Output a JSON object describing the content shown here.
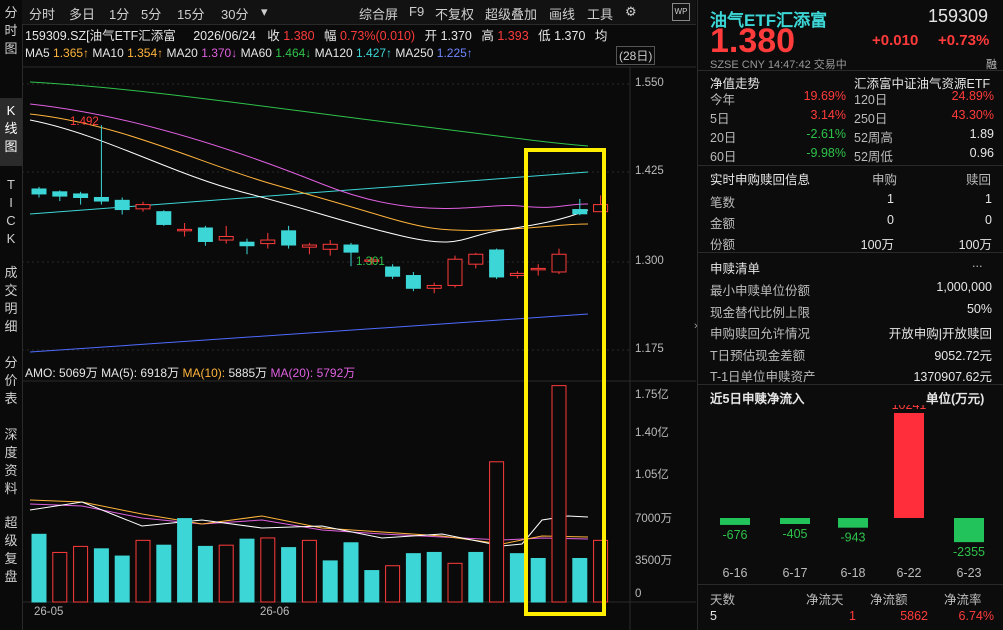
{
  "leftnav": {
    "items": [
      {
        "label": "分\n时\n图"
      },
      {
        "label": "K\n线\n图"
      },
      {
        "label": "T\nI\nC\nK"
      },
      {
        "label": "成\n交\n明\n细"
      },
      {
        "label": "分\n价\n表"
      },
      {
        "label": "深\n度\n资\n料"
      },
      {
        "label": "超\n级\n复\n盘"
      }
    ]
  },
  "toolbar": {
    "periods": [
      "分时",
      "多日",
      "1分",
      "5分",
      "15分",
      "30分"
    ],
    "dropdown": "▾",
    "actions": [
      "综合屏",
      "F9",
      "不复权",
      "超级叠加",
      "画线",
      "工具"
    ],
    "settings_icon": "gear-icon",
    "wp_badge": "WP"
  },
  "header": {
    "code_name": "159309.SZ[油气ETF汇添富",
    "date": "2026/06/24",
    "close_label": "收",
    "close_value": "1.380",
    "change_label": "幅",
    "change_value": "0.73%(0.010)",
    "open_label": "开",
    "open_value": "1.370",
    "high_label": "高",
    "high_value": "1.393",
    "low_label": "低",
    "low_value": "1.370",
    "avg_label": "均"
  },
  "ma_line": {
    "ma5": {
      "label": "MA5",
      "value": "1.365↑",
      "color": "#ffffff"
    },
    "ma10": {
      "label": "MA10",
      "value": "1.354↑",
      "color": "#ffb43c"
    },
    "ma20": {
      "label": "MA20",
      "value": "1.370↓",
      "color": "#e060e0"
    },
    "ma60": {
      "label": "MA60",
      "value": "1.464↓",
      "color": "#2fc24b"
    },
    "ma120": {
      "label": "MA120",
      "value": "1.427↑",
      "color": "#3dd6d6"
    },
    "ma250": {
      "label": "MA250",
      "value": "1.225↑",
      "color": "#4f6cff"
    },
    "period_tag": "(28日)"
  },
  "price_axis": [
    "1.550",
    "1.425",
    "1.300",
    "1.175"
  ],
  "annotations": {
    "high": "1.492",
    "low": "1.301"
  },
  "volume": {
    "amo_label": "AMO:",
    "amo_value": "5069万",
    "ma5_label": "MA(5):",
    "ma5_value": "6918万",
    "ma10_label": "MA(10):",
    "ma10_value": "5885万",
    "ma20_label": "MA(20):",
    "ma20_value": "5792万",
    "axis": [
      "1.75亿",
      "1.40亿",
      "1.05亿",
      "7000万",
      "3500万",
      "0"
    ]
  },
  "date_axis": [
    "26-05",
    "26-06"
  ],
  "chart_data": {
    "type": "candlestick",
    "ylim": [
      1.16,
      1.57
    ],
    "candles": [
      {
        "o": 1.402,
        "c": 1.395,
        "h": 1.405,
        "l": 1.39
      },
      {
        "o": 1.398,
        "c": 1.392,
        "h": 1.4,
        "l": 1.385
      },
      {
        "o": 1.395,
        "c": 1.39,
        "h": 1.398,
        "l": 1.38
      },
      {
        "o": 1.39,
        "c": 1.385,
        "h": 1.492,
        "l": 1.38
      },
      {
        "o": 1.386,
        "c": 1.373,
        "h": 1.39,
        "l": 1.366
      },
      {
        "o": 1.374,
        "c": 1.38,
        "h": 1.384,
        "l": 1.37
      },
      {
        "o": 1.37,
        "c": 1.352,
        "h": 1.372,
        "l": 1.35
      },
      {
        "o": 1.343,
        "c": 1.345,
        "h": 1.354,
        "l": 1.335
      },
      {
        "o": 1.347,
        "c": 1.328,
        "h": 1.35,
        "l": 1.322
      },
      {
        "o": 1.33,
        "c": 1.335,
        "h": 1.35,
        "l": 1.325
      },
      {
        "o": 1.327,
        "c": 1.322,
        "h": 1.332,
        "l": 1.31
      },
      {
        "o": 1.325,
        "c": 1.33,
        "h": 1.34,
        "l": 1.318
      },
      {
        "o": 1.343,
        "c": 1.323,
        "h": 1.35,
        "l": 1.318
      },
      {
        "o": 1.32,
        "c": 1.323,
        "h": 1.326,
        "l": 1.31
      },
      {
        "o": 1.317,
        "c": 1.324,
        "h": 1.33,
        "l": 1.308
      },
      {
        "o": 1.323,
        "c": 1.313,
        "h": 1.326,
        "l": 1.293
      },
      {
        "o": 1.3,
        "c": 1.302,
        "h": 1.306,
        "l": 1.295
      },
      {
        "o": 1.292,
        "c": 1.279,
        "h": 1.296,
        "l": 1.275
      },
      {
        "o": 1.28,
        "c": 1.262,
        "h": 1.285,
        "l": 1.258
      },
      {
        "o": 1.262,
        "c": 1.266,
        "h": 1.27,
        "l": 1.255
      },
      {
        "o": 1.266,
        "c": 1.303,
        "h": 1.308,
        "l": 1.263
      },
      {
        "o": 1.296,
        "c": 1.31,
        "h": 1.312,
        "l": 1.29
      },
      {
        "o": 1.316,
        "c": 1.278,
        "h": 1.318,
        "l": 1.275
      },
      {
        "o": 1.28,
        "c": 1.283,
        "h": 1.286,
        "l": 1.276
      },
      {
        "o": 1.288,
        "c": 1.29,
        "h": 1.296,
        "l": 1.28
      },
      {
        "o": 1.285,
        "c": 1.31,
        "h": 1.318,
        "l": 1.282
      },
      {
        "o": 1.373,
        "c": 1.367,
        "h": 1.388,
        "l": 1.365
      },
      {
        "o": 1.37,
        "c": 1.38,
        "h": 1.393,
        "l": 1.37
      }
    ],
    "volumes": [
      5.6,
      4.1,
      4.6,
      4.4,
      3.8,
      5.1,
      4.7,
      6.9,
      4.6,
      4.7,
      5.2,
      5.3,
      4.5,
      5.1,
      3.4,
      4.9,
      2.6,
      3.0,
      4.0,
      4.1,
      3.2,
      4.1,
      11.6,
      4.0,
      3.6,
      17.9,
      3.6,
      5.1
    ],
    "volume_up": [
      false,
      true,
      true,
      false,
      false,
      true,
      false,
      false,
      false,
      true,
      false,
      true,
      false,
      true,
      false,
      false,
      false,
      true,
      false,
      false,
      true,
      false,
      true,
      false,
      false,
      true,
      false,
      true
    ],
    "volume_ylim": [
      0,
      18.2
    ]
  },
  "quote": {
    "name": "油气ETF汇添富",
    "code": "159309",
    "price": "1.380",
    "change": "+0.010",
    "change_pct": "+0.73%",
    "exchange": "SZSE",
    "currency": "CNY",
    "time": "14:47:42",
    "status": "交易中",
    "tag": "融"
  },
  "nav_section": {
    "title": "净值走势",
    "index_name": "汇添富中证油气资源ETF",
    "rows": [
      {
        "l1": "今年",
        "v1": "19.69%",
        "l2": "120日",
        "v2": "24.89%",
        "c1": "red",
        "c2": "red"
      },
      {
        "l1": "5日",
        "v1": "3.14%",
        "l2": "250日",
        "v2": "43.30%",
        "c1": "red",
        "c2": "red"
      },
      {
        "l1": "20日",
        "v1": "-2.61%",
        "l2": "52周高",
        "v2": "1.89",
        "c1": "green",
        "c2": "white"
      },
      {
        "l1": "60日",
        "v1": "-9.98%",
        "l2": "52周低",
        "v2": "0.96",
        "c1": "green",
        "c2": "white"
      }
    ]
  },
  "realtime": {
    "title": "实时申购赎回信息",
    "col1": "申购",
    "col2": "赎回",
    "rows": [
      {
        "label": "笔数",
        "v1": "1",
        "v2": "1"
      },
      {
        "label": "金额",
        "v1": "0",
        "v2": "0"
      },
      {
        "label": "份额",
        "v1": "100万",
        "v2": "100万"
      }
    ]
  },
  "list": {
    "title": "申赎清单",
    "more": "...",
    "rows": [
      {
        "label": "最小申赎单位份额",
        "value": "1,000,000"
      },
      {
        "label": "现金替代比例上限",
        "value": "50%"
      },
      {
        "label": "申购赎回允许情况",
        "value": "开放申购|开放赎回"
      },
      {
        "label": "T日预估现金差额",
        "value": "9052.72元"
      },
      {
        "label": "T-1日单位申赎资产",
        "value": "1370907.62元"
      }
    ]
  },
  "flow": {
    "title": "近5日申赎净流入",
    "unit": "单位(万元)",
    "bars": [
      {
        "date": "6-16",
        "value": -676
      },
      {
        "date": "6-17",
        "value": -405
      },
      {
        "date": "6-18",
        "value": -943
      },
      {
        "date": "6-22",
        "value": 10241
      },
      {
        "date": "6-23",
        "value": -2355
      }
    ],
    "footer_headers": [
      "天数",
      "净流天",
      "净流额",
      "净流率"
    ],
    "footer_values": [
      "5",
      "1",
      "5862",
      "6.74%"
    ]
  }
}
